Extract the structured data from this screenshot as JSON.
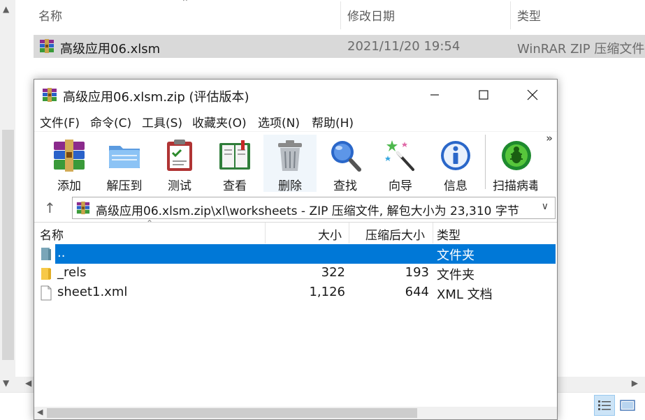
{
  "explorer": {
    "columns": {
      "name": "名称",
      "modified": "修改日期",
      "type": "类型"
    },
    "row": {
      "name": "高级应用06.xlsm",
      "modified": "2021/11/20 19:54",
      "type": "WinRAR ZIP 压缩文件"
    }
  },
  "winrar": {
    "title": "高级应用06.xlsm.zip (评估版本)",
    "menu": [
      "文件(F)",
      "命令(C)",
      "工具(S)",
      "收藏夹(O)",
      "选项(N)",
      "帮助(H)"
    ],
    "toolbar": [
      {
        "label": "添加",
        "icon": "add-archive-icon"
      },
      {
        "label": "解压到",
        "icon": "extract-folder-icon"
      },
      {
        "label": "测试",
        "icon": "test-clipboard-icon"
      },
      {
        "label": "查看",
        "icon": "view-book-icon"
      },
      {
        "label": "删除",
        "icon": "trash-can-icon"
      },
      {
        "label": "查找",
        "icon": "magnifier-icon"
      },
      {
        "label": "向导",
        "icon": "wizard-wand-icon"
      },
      {
        "label": "信息",
        "icon": "info-icon"
      },
      {
        "label": "扫描病毒",
        "icon": "virus-scan-icon"
      }
    ],
    "path": "高级应用06.xlsm.zip\\xl\\worksheets - ZIP 压缩文件, 解包大小为 23,310 字节",
    "list": {
      "columns": {
        "name": "名称",
        "size": "大小",
        "packed": "压缩后大小",
        "type": "类型"
      },
      "rows": [
        {
          "name": "..",
          "size": "",
          "packed": "",
          "type": "文件夹",
          "icon": "parent-folder-icon",
          "selected": true
        },
        {
          "name": "_rels",
          "size": "322",
          "packed": "193",
          "type": "文件夹",
          "icon": "folder-icon",
          "selected": false
        },
        {
          "name": "sheet1.xml",
          "size": "1,126",
          "packed": "644",
          "type": "XML 文档",
          "icon": "document-icon",
          "selected": false
        }
      ]
    }
  },
  "colors": {
    "selection": "#0078d7",
    "explorer_row": "#d9d9d9"
  }
}
